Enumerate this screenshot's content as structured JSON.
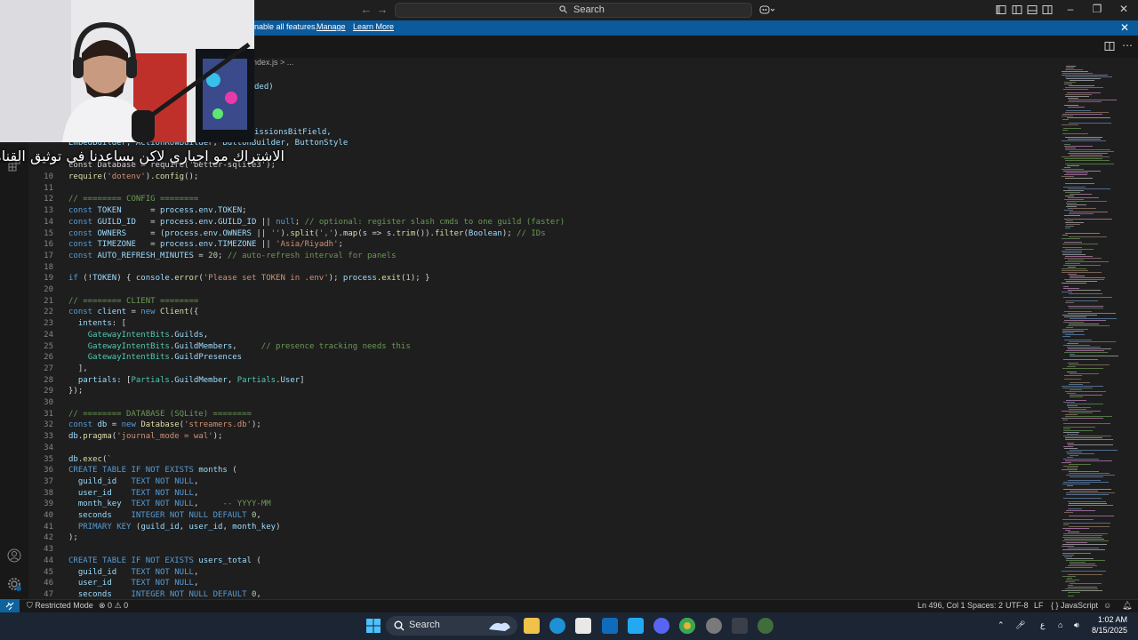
{
  "titlebar": {
    "search_label": "Search",
    "back_arrow": "←",
    "forward_arrow": "→"
  },
  "banner": {
    "message": "nable all features.",
    "manage_link": "Manage",
    "learn_more_link": "Learn More",
    "close": "✕"
  },
  "breadcrumb": "ndex.js > ...",
  "overlay_caption": "الاشتراك مو اجباري لاكن بساعدنا في توثيق القناه",
  "editor": {
    "visible_line_numbers": [
      10,
      11,
      12,
      13,
      14,
      15,
      16,
      17,
      18,
      19,
      20,
      21,
      22,
      23,
      24,
      25,
      26,
      27,
      28,
      29,
      30,
      31,
      32,
      33,
      34,
      35,
      36,
      37,
      38,
      39,
      40,
      41,
      42,
      43,
      44,
      45,
      46,
      47
    ],
    "partial_top_lines": {
      "l1": "ded)",
      "l2": "issionsBitField,",
      "l3": "EmbedBuilder, ActionRowBuilder, ButtonBuilder, ButtonStyle",
      "l4": "const Database = require('better-sqlite3');"
    },
    "lines": [
      "require('dotenv').config();",
      "",
      "// ======== CONFIG ========",
      "const TOKEN      = process.env.TOKEN;",
      "const GUILD_ID   = process.env.GUILD_ID || null; // optional: register slash cmds to one guild (faster)",
      "const OWNERS     = (process.env.OWNERS || '').split(',').map(s => s.trim()).filter(Boolean); // IDs",
      "const TIMEZONE   = process.env.TIMEZONE || 'Asia/Riyadh';",
      "const AUTO_REFRESH_MINUTES = 20; // auto-refresh interval for panels",
      "",
      "if (!TOKEN) { console.error('Please set TOKEN in .env'); process.exit(1); }",
      "",
      "// ======== CLIENT ========",
      "const client = new Client({",
      "  intents: [",
      "    GatewayIntentBits.Guilds,",
      "    GatewayIntentBits.GuildMembers,     // presence tracking needs this",
      "    GatewayIntentBits.GuildPresences",
      "  ],",
      "  partials: [Partials.GuildMember, Partials.User]",
      "});",
      "",
      "// ======== DATABASE (SQLite) ========",
      "const db = new Database('streamers.db');",
      "db.pragma('journal_mode = wal');",
      "",
      "db.exec(`",
      "CREATE TABLE IF NOT EXISTS months (",
      "  guild_id   TEXT NOT NULL,",
      "  user_id    TEXT NOT NULL,",
      "  month_key  TEXT NOT NULL,     -- YYYY-MM",
      "  seconds    INTEGER NOT NULL DEFAULT 0,",
      "  PRIMARY KEY (guild_id, user_id, month_key)",
      ");",
      "",
      "CREATE TABLE IF NOT EXISTS users_total (",
      "  guild_id   TEXT NOT NULL,",
      "  user_id    TEXT NOT NULL,",
      "  seconds    INTEGER NOT NULL DEFAULT 0,"
    ]
  },
  "statusbar": {
    "restricted_mode": "Restricted Mode",
    "problems": "0",
    "warnings": "0",
    "cursor": "Ln 496, Col 1",
    "spaces": "Spaces: 2",
    "encoding": "UTF-8",
    "eol": "LF",
    "language": "{ } JavaScript"
  },
  "taskbar": {
    "search_label": "Search",
    "time": "1:02 AM",
    "date": "8/15/2025",
    "lang": "ع",
    "app_icons": [
      "windows-start-icon",
      "file-explorer-icon",
      "edge-icon",
      "store-icon",
      "outlook-icon",
      "vscode-icon",
      "discord-icon",
      "chrome-icon",
      "app-icon",
      "app-icon-2",
      "app-icon-3"
    ]
  },
  "colors": {
    "editor_bg": "#1e1e1e",
    "banner_bg": "#0b5a9b",
    "taskbar_bg": "#1c2533",
    "remote_bg": "#0e639c"
  }
}
